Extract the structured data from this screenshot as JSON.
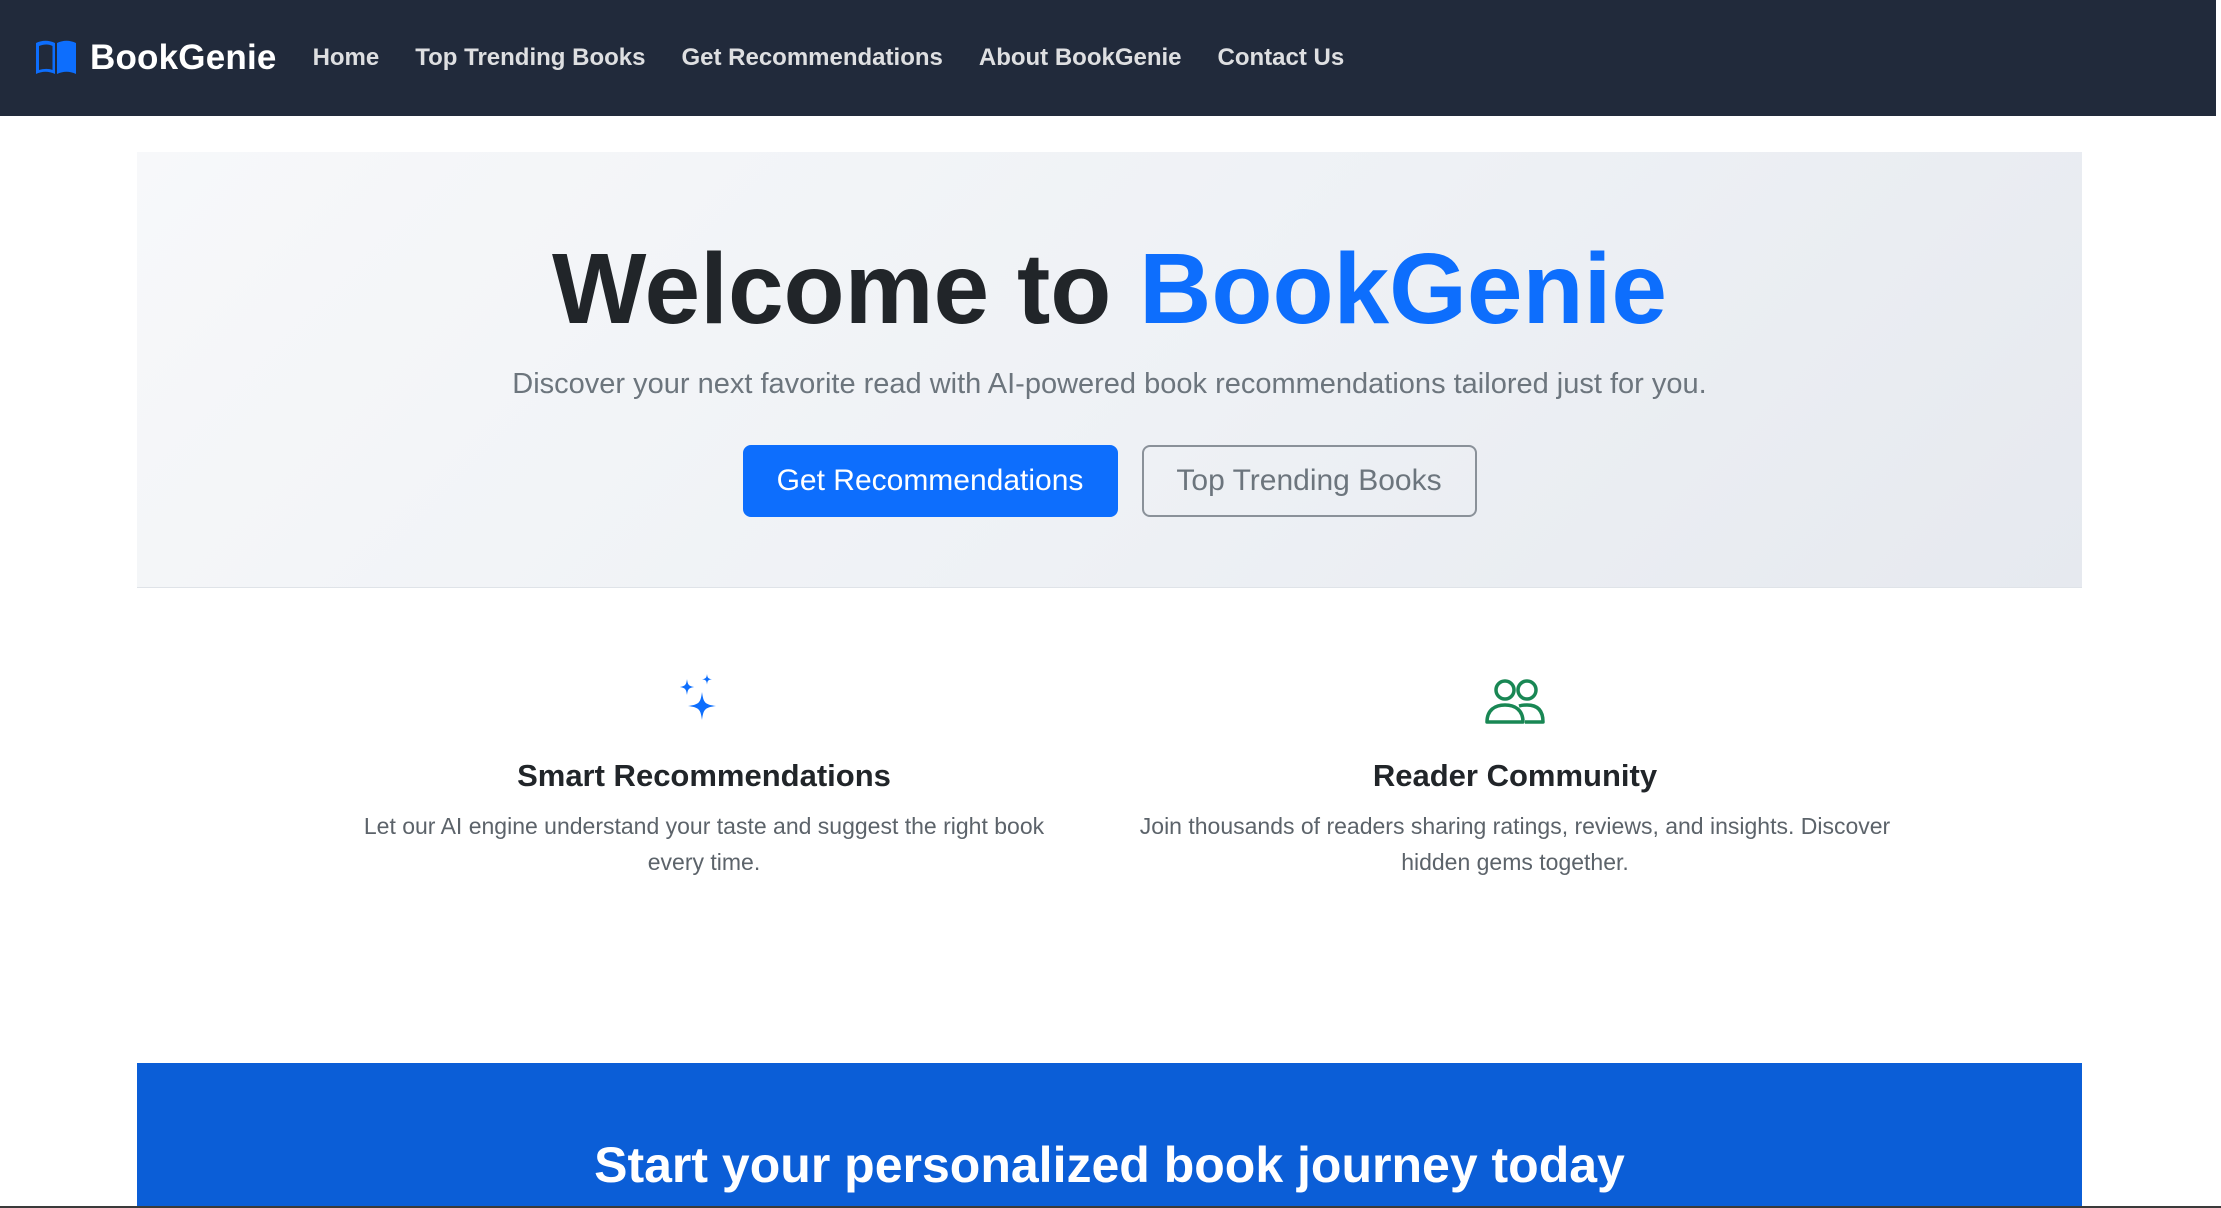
{
  "navbar": {
    "brand": "BookGenie",
    "brand_icon": "open-book-icon",
    "links": [
      "Home",
      "Top Trending Books",
      "Get Recommendations",
      "About BookGenie",
      "Contact Us"
    ]
  },
  "hero": {
    "title_prefix": "Welcome to",
    "title_accent": "BookGenie",
    "subtitle": "Discover your next favorite read with AI-powered book recommendations tailored just for you.",
    "primary_button": "Get Recommendations",
    "secondary_button": "Top Trending Books"
  },
  "features": [
    {
      "icon": "sparkles-icon",
      "icon_color": "#0d6efd",
      "title": "Smart Recommendations",
      "text_line1": "Let our AI engine understand your taste and suggest the right book",
      "text_line2": "every time."
    },
    {
      "icon": "people-icon",
      "icon_color": "#198754",
      "title": "Reader Community",
      "text_line1": "Join thousands of readers sharing ratings, reviews, and insights. Discover",
      "text_line2": "hidden gems together."
    }
  ],
  "cta": {
    "title": "Start your personalized book journey today"
  },
  "colors": {
    "navbar_bg": "#212a3b",
    "accent": "#0d6efd",
    "cta_bg": "#0b5ed7",
    "community_green": "#198754"
  }
}
